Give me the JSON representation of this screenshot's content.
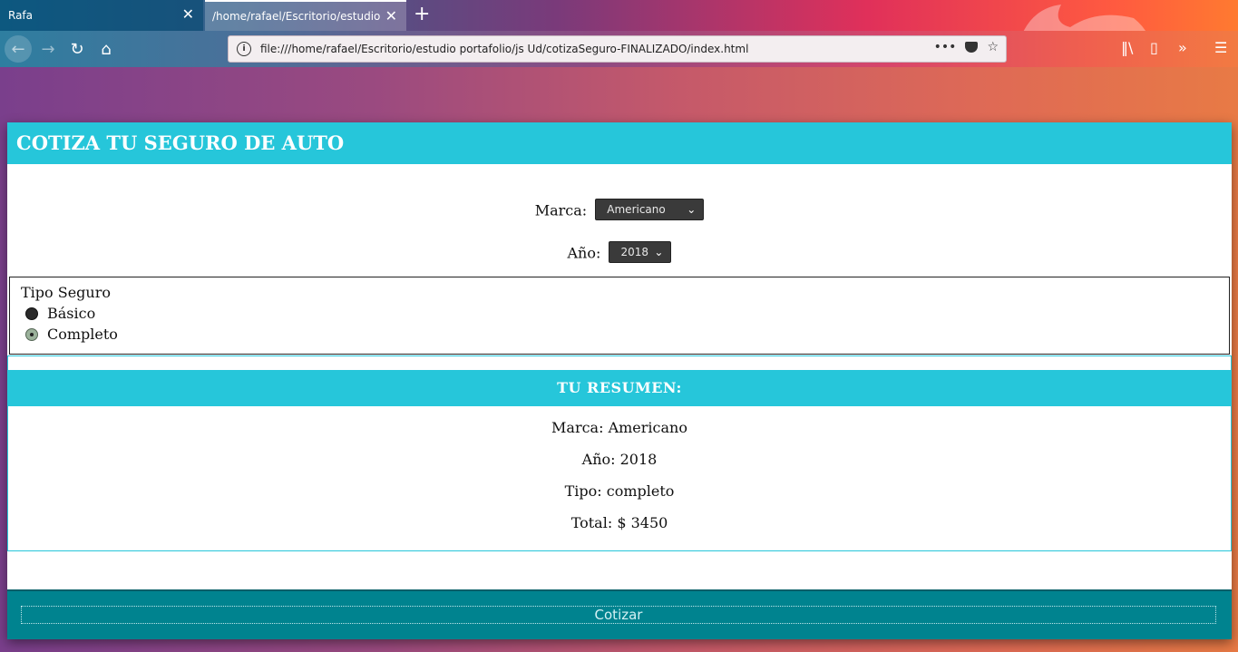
{
  "browser": {
    "tabs": [
      {
        "label": "Rafa",
        "active": false
      },
      {
        "label": "/home/rafael/Escritorio/estudio%",
        "active": true
      }
    ],
    "url": "file:///home/rafael/Escritorio/estudio portafolio/js Ud/cotizaSeguro-FINALIZADO/index.html",
    "icons": [
      "back-icon",
      "forward-icon",
      "reload-icon",
      "home-icon",
      "info-icon",
      "more-icon",
      "pocket-icon",
      "bookmark-star-icon",
      "library-icon",
      "sidebar-icon",
      "overflow-icon",
      "menu-icon"
    ]
  },
  "app": {
    "title": "COTIZA TU SEGURO DE AUTO",
    "marca": {
      "label": "Marca:",
      "selected": "Americano"
    },
    "anio": {
      "label": "Año:",
      "selected": "2018"
    },
    "tipo": {
      "title": "Tipo Seguro",
      "options": [
        {
          "label": "Básico",
          "checked": false
        },
        {
          "label": "Completo",
          "checked": true
        }
      ]
    },
    "resumen": {
      "title": "TU RESUMEN:",
      "marca": "Marca: Americano",
      "anio": "Año: 2018",
      "tipo": "Tipo: completo",
      "total": "Total: $ 3450"
    },
    "submit_label": "Cotizar"
  },
  "colors": {
    "accent": "#26c6da",
    "button": "#00838f"
  }
}
